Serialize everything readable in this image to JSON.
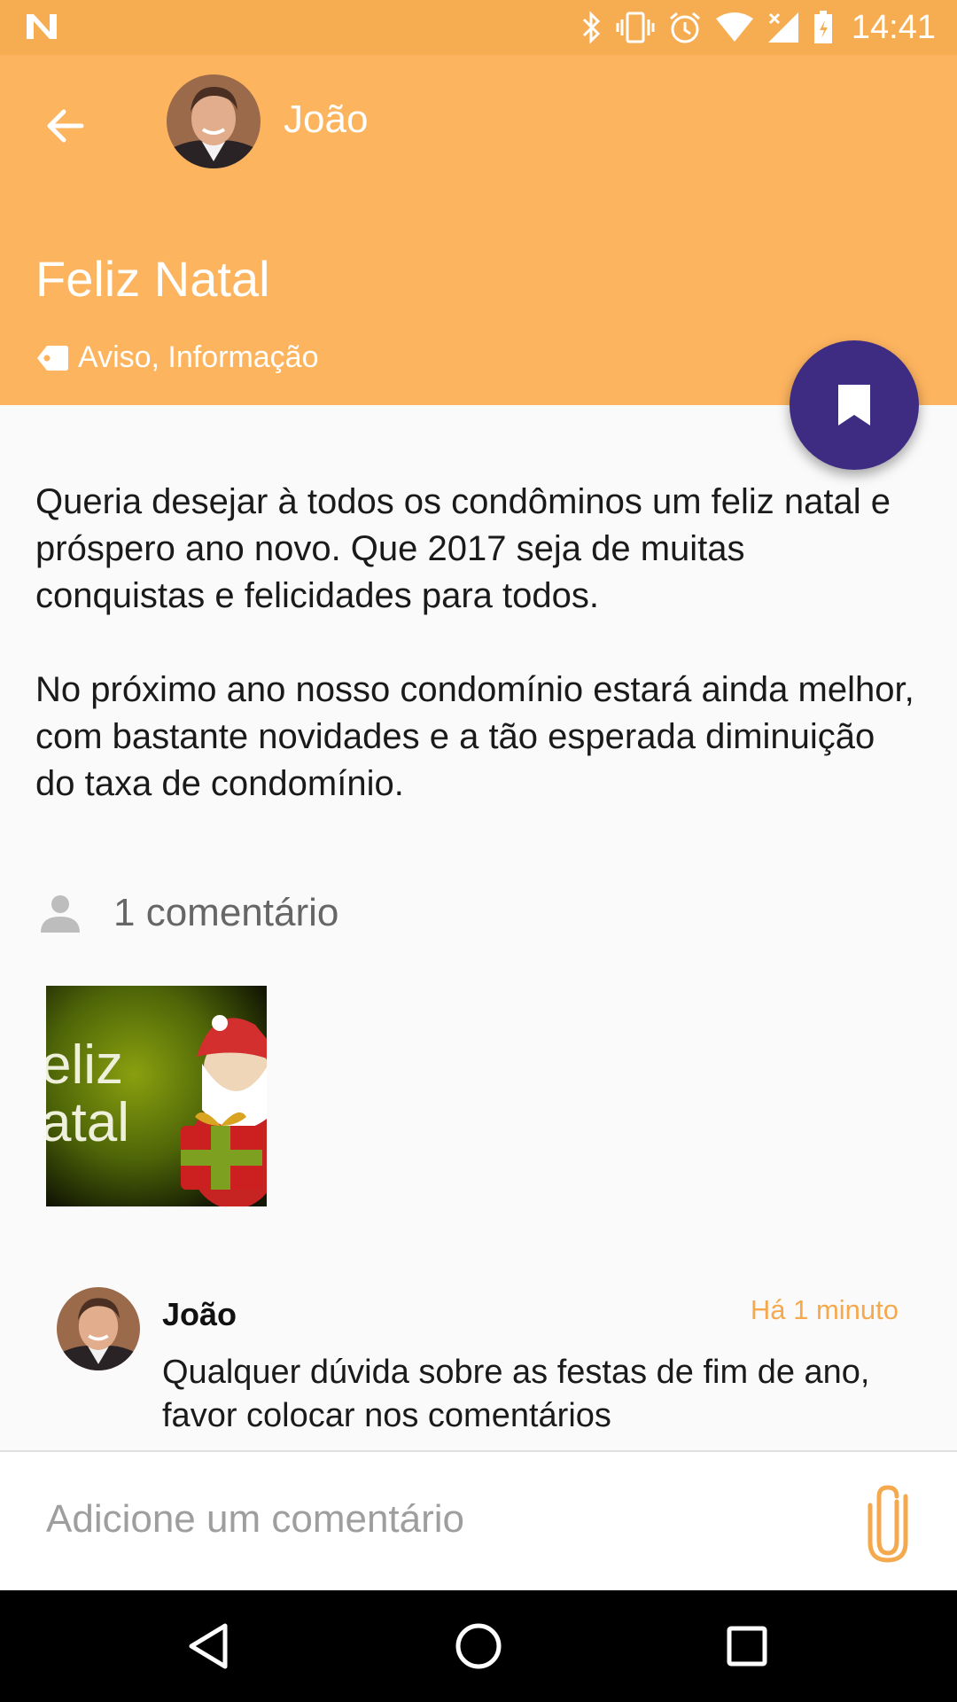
{
  "status_bar": {
    "time": "14:41",
    "icons": [
      "n-notification-icon",
      "bluetooth-icon",
      "vibrate-icon",
      "alarm-icon",
      "wifi-icon",
      "signal-icon",
      "battery-charging-icon"
    ]
  },
  "header": {
    "author_name": "João",
    "title": "Feliz Natal",
    "tags": "Aviso, Informação"
  },
  "post": {
    "paragraphs": [
      "Queria desejar à todos os condôminos um feliz natal e próspero ano novo. Que 2017 seja de muitas conquistas e felicidades para todos.",
      "No próximo ano nosso condomínio estará ainda melhor, com bastante novidades e a tão esperada diminuição do taxa de condomínio."
    ],
    "attachment_text": [
      "eliz",
      "atal"
    ]
  },
  "comments": {
    "count_label": "1 comentário",
    "items": [
      {
        "author": "João",
        "time": "Há 1 minuto",
        "text": "Qualquer dúvida sobre as festas de fim de ano, favor colocar nos comentários"
      }
    ]
  },
  "composer": {
    "placeholder": "Adicione um comentário",
    "value": ""
  },
  "colors": {
    "status_bar": "#f6ad52",
    "app_bar": "#fdb45f",
    "fab": "#3d2c82",
    "comment_time": "#f5a94f"
  }
}
